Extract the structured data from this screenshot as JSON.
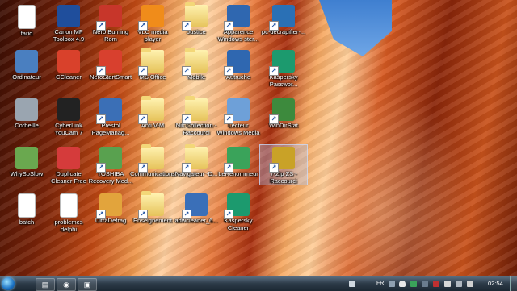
{
  "desktop_icons": [
    {
      "label": "farid",
      "icon": "doc-icon",
      "color": "#ffffff"
    },
    {
      "label": "Ordinateur",
      "icon": "computer-icon",
      "color": "#4a7fc0"
    },
    {
      "label": "Corbeille",
      "icon": "recycle-bin-icon",
      "color": "#9aa5b0"
    },
    {
      "label": "WhySoSlow",
      "icon": "whysoslow-icon",
      "color": "#6aa84f"
    },
    {
      "label": "batch",
      "icon": "doc-icon",
      "color": "#ffffff"
    },
    {
      "label": "Canon MF\nToolbox 4.9",
      "icon": "canon-icon",
      "color": "#1f4e9c"
    },
    {
      "label": "CCleaner",
      "icon": "ccleaner-icon",
      "color": "#d9412b"
    },
    {
      "label": "CyberLink\nYouCam 7",
      "icon": "youcam-icon",
      "color": "#222222"
    },
    {
      "label": "Duplicate\nCleaner Free",
      "icon": "duplicate-icon",
      "color": "#d53b3b"
    },
    {
      "label": "problemes\ndelphi",
      "icon": "doc-icon",
      "color": "#ffffff"
    },
    {
      "label": "Nero Burning\nRom",
      "icon": "nero-icon",
      "color": "#c7362a"
    },
    {
      "label": "NeroStartSmart",
      "icon": "nero-smart-icon",
      "color": "#d8402e"
    },
    {
      "label": "Prestol\nPageManag...",
      "icon": "prestol-icon",
      "color": "#3b6fb6"
    },
    {
      "label": "TOSHIBA\nRecovery Med...",
      "icon": "toshiba-icon",
      "color": "#59a14f"
    },
    {
      "label": "UltraDefrag",
      "icon": "ultradefrag-icon",
      "color": "#e2a43c"
    },
    {
      "label": "VLC media\nplayer",
      "icon": "vlc-icon",
      "color": "#f08c1a"
    },
    {
      "label": "MS Office",
      "icon": "folder-icon",
      "color": "#e6c35a"
    },
    {
      "label": "Anti V-M",
      "icon": "folder-icon",
      "color": "#e6c35a"
    },
    {
      "label": "Communications",
      "icon": "folder-icon",
      "color": "#e6c35a"
    },
    {
      "label": "Enseignement",
      "icon": "folder-icon",
      "color": "#e6c35a"
    },
    {
      "label": "Justice",
      "icon": "folder-icon",
      "color": "#e6c35a"
    },
    {
      "label": "Mobile",
      "icon": "folder-icon",
      "color": "#e6c35a"
    },
    {
      "label": "Nik Collection -\nRaccourci",
      "icon": "folder-icon",
      "color": "#e6c35a"
    },
    {
      "label": "Navigateur -D...",
      "icon": "folder-icon",
      "color": "#e6c35a"
    },
    {
      "label": "adwcleaner_6...",
      "icon": "adwcleaner-icon",
      "color": "#3a6fb8"
    },
    {
      "label": "Apparence\nWindows ster...",
      "icon": "windows-app-icon",
      "color": "#2f67b0"
    },
    {
      "label": "Autruche",
      "icon": "autruche-icon",
      "color": "#2f67b0"
    },
    {
      "label": "Lecteur\nWindows Media",
      "icon": "media-player-icon",
      "color": "#6ea0d8"
    },
    {
      "label": "LeRenommeur",
      "icon": "renommeur-icon",
      "color": "#3aa35a"
    },
    {
      "label": "Kaspersky\nCleaner",
      "icon": "kaspersky-icon",
      "color": "#1c9a6e"
    },
    {
      "label": "pc-decrapifier-...",
      "icon": "pc-decrapifier-icon",
      "color": "#2a70b5"
    },
    {
      "label": "Kaspersky\nPasswor...",
      "icon": "kaspersky-icon",
      "color": "#1c9a6e"
    },
    {
      "label": "WinDirStat",
      "icon": "windirstat-icon",
      "color": "#3d8a3d"
    },
    {
      "label": "7-Zip ZS -\nRaccourci",
      "icon": "7zip-icon",
      "color": "#c9a227"
    }
  ],
  "taskbar": {
    "pinned": [
      {
        "name": "explorer-icon",
        "glyph": "▤"
      },
      {
        "name": "chrome-icon",
        "glyph": "◉"
      },
      {
        "name": "save-icon",
        "glyph": "▣"
      }
    ],
    "language": "FR",
    "clock": "02:54"
  }
}
